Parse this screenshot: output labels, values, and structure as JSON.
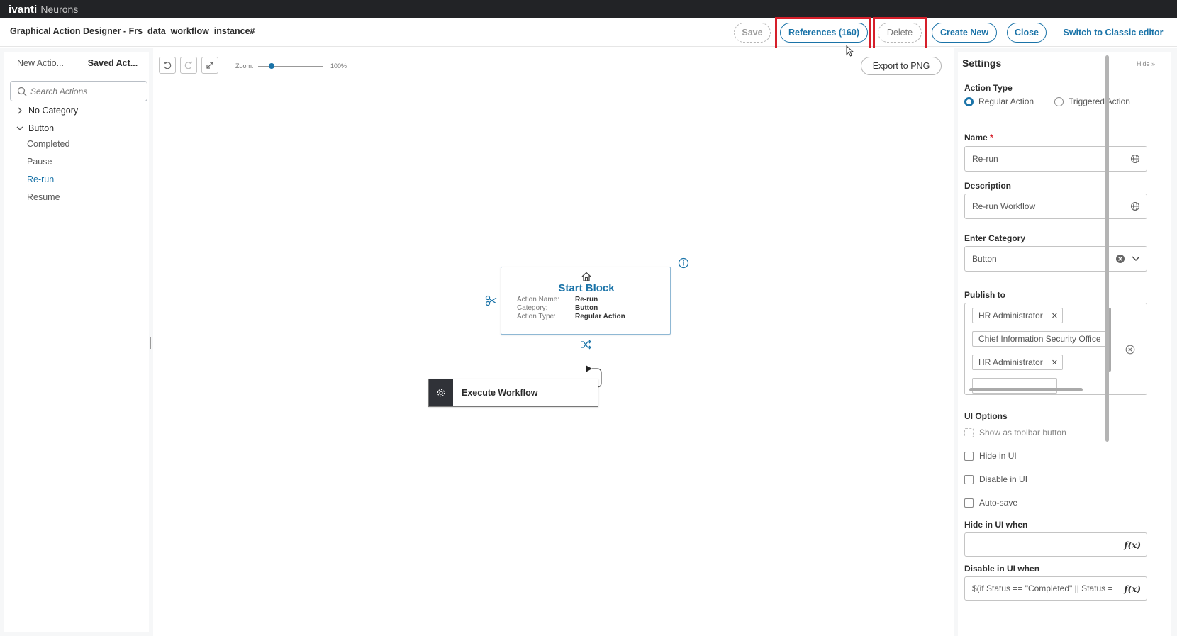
{
  "brand": {
    "logo": "ivanti",
    "product": "Neurons"
  },
  "header": {
    "title": "Graphical Action Designer - Frs_data_workflow_instance#",
    "save": "Save",
    "references": "References (160)",
    "delete": "Delete",
    "create_new": "Create New",
    "close": "Close",
    "switch_classic": "Switch to Classic editor"
  },
  "left_panel": {
    "tabs": [
      "New Actio...",
      "Saved Act..."
    ],
    "search_placeholder": "Search Actions",
    "categories": [
      {
        "label": "No Category",
        "expanded": false
      },
      {
        "label": "Button",
        "expanded": true,
        "children": [
          "Completed",
          "Pause",
          "Re-run",
          "Resume"
        ]
      }
    ],
    "selected": "Re-run"
  },
  "canvas": {
    "zoom_label": "Zoom:",
    "zoom_value": "100%",
    "export": "Export to PNG",
    "start_block": {
      "title": "Start Block",
      "rows": [
        {
          "key": "Action Name:",
          "value": "Re-run"
        },
        {
          "key": "Category:",
          "value": "Button"
        },
        {
          "key": "Action Type:",
          "value": "Regular Action"
        }
      ]
    },
    "execute_block": {
      "label": "Execute Workflow"
    }
  },
  "settings": {
    "title": "Settings",
    "hide": "Hide",
    "action_type_label": "Action Type",
    "action_types": [
      "Regular Action",
      "Triggered Action"
    ],
    "action_type_selected": "Regular Action",
    "name_label": "Name",
    "name_value": "Re-run",
    "description_label": "Description",
    "description_value": "Re-run Workflow",
    "category_label": "Enter Category",
    "category_value": "Button",
    "publish_label": "Publish to",
    "publish_chips": [
      "HR Administrator",
      "Chief Information Security Office",
      "HR Administrator"
    ],
    "ui_options_label": "UI Options",
    "options": [
      {
        "label": "Show as toolbar button",
        "checked": false,
        "disabled": true
      },
      {
        "label": "Hide in UI",
        "checked": false,
        "disabled": false
      },
      {
        "label": "Disable in UI",
        "checked": false,
        "disabled": false
      },
      {
        "label": "Auto-save",
        "checked": false,
        "disabled": false
      }
    ],
    "hide_when_label": "Hide in UI when",
    "hide_when_value": "",
    "disable_when_label": "Disable in UI when",
    "disable_when_value": "$(if Status == \"Completed\" || Status =",
    "fx": "f(x)"
  },
  "colors": {
    "accent": "#1a73a8",
    "highlight": "#d61f2a",
    "brand_bar": "#222326"
  }
}
